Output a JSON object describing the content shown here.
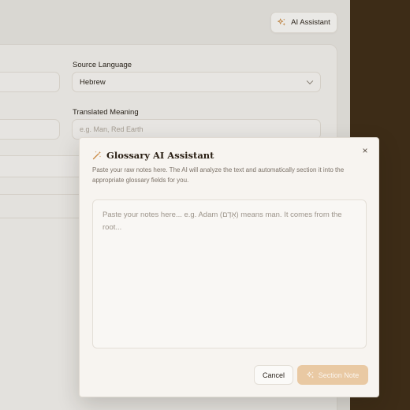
{
  "header": {
    "ai_assistant_label": "AI Assistant"
  },
  "form": {
    "source_language": {
      "label": "Source Language",
      "value": "Hebrew"
    },
    "translated_meaning": {
      "label": "Translated Meaning",
      "placeholder": "e.g. Man, Red Earth"
    }
  },
  "dialog": {
    "title": "Glossary AI Assistant",
    "description": "Paste your raw notes here. The AI will analyze the text and automatically section it into the appropriate glossary fields for you.",
    "textarea_placeholder": "Paste your notes here... e.g. Adam (אָדָם) means man. It comes from the root...",
    "cancel_label": "Cancel",
    "submit_label": "Section Note",
    "close_icon": "×"
  },
  "colors": {
    "accent": "#c98a45",
    "dark_panel": "#3f2d17",
    "submit_bg": "#e9c9a3"
  },
  "icons": {
    "ai": "sparkles-icon",
    "title": "magic-wand-icon",
    "chevron": "chevron-down-icon",
    "close": "close-icon"
  }
}
